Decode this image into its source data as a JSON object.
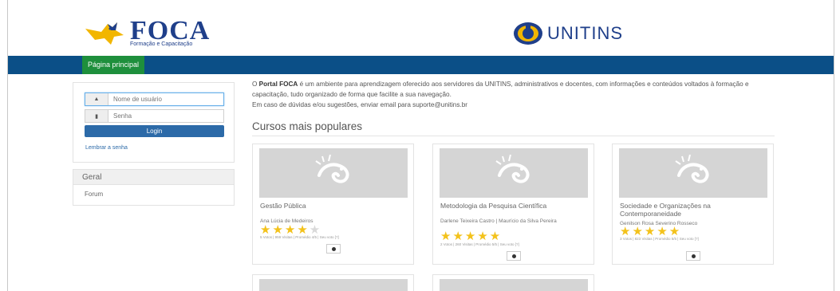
{
  "header": {
    "foca_logo_text": "FOCA",
    "foca_logo_subtitle": "Formação e Capacitação",
    "unitins_logo_text": "UNITINS"
  },
  "nav": {
    "home_label": "Página principal"
  },
  "login": {
    "username_placeholder": "Nome de usuário",
    "password_placeholder": "Senha",
    "login_button": "Login",
    "forgot_link": "Lembrar a senha"
  },
  "sidebar": {
    "geral_title": "Geral",
    "forum_link": "Forum"
  },
  "intro": {
    "brand": "Portal FOCA",
    "line1": " é um ambiente para aprendizagem oferecido aos servidores da UNITINS, administrativos e docentes, com informações e conteúdos voltados à formação e capacitação, tudo organizado de forma que facilite a sua navegação.",
    "line2": "Em caso de dúvidas e/ou sugestões, enviar email para suporte@unitins.br"
  },
  "popular": {
    "title": "Cursos mais populares",
    "courses": [
      {
        "title": "Gestão Pública",
        "teacher": "Ana Lúcia de Medeiros",
        "rating": 4,
        "stats": "5 Votos | 959 Visitas | Promédio 4/5 | Seu voto [?]"
      },
      {
        "title": "Metodologia da Pesquisa Científica",
        "teacher": "Darlene Teixeira Castro | Maurício da Silva Pereira",
        "rating": 5,
        "stats": "2 Votos | 260 Visitas | Promédio 5/5 | Seu voto [?]"
      },
      {
        "title": "Sociedade e Organizações na Contemporaneidade",
        "teacher": "Genilson Rosa Severino Rosseco",
        "rating": 5,
        "stats": "3 Votos | 823 Visitas | Promédio 5/5 | Seu voto [?]"
      }
    ]
  },
  "colors": {
    "navbar": "#0b4f87",
    "home_button": "#1e8f3c",
    "login_button": "#2c6aa8",
    "star": "#f3c21b"
  }
}
